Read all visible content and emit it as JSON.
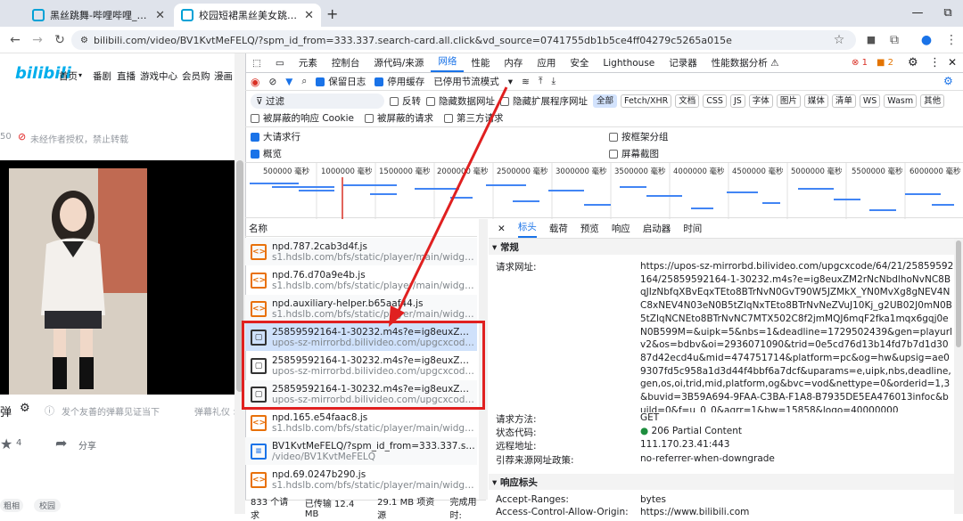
{
  "browser": {
    "tabs": [
      {
        "title": "黑丝跳舞-哔哩哔哩_bilibili",
        "active": false
      },
      {
        "title": "校园短裙黑丝美女跳舞。_哔哩哔",
        "active": true
      }
    ],
    "new_tab": "+",
    "url": "bilibili.com/video/BV1KvtMeFELQ/?spm_id_from=333.337.search-card.all.click&vd_source=0741755db1b5ce4ff04279c5265a015e",
    "window": {
      "minimize": "—",
      "restore": "⧉"
    }
  },
  "site": {
    "logo": "bilibili",
    "nav": [
      "首页",
      "番剧",
      "直播",
      "游戏中心",
      "会员购",
      "漫画"
    ],
    "meta": "50",
    "no_repost": "未经作者授权，禁止转载",
    "danmaku_placeholder": "发个友善的弹幕见证当下",
    "danmaku_etiquette": "弹幕礼仪 >",
    "coin_count": "4",
    "share": "分享",
    "tags": [
      "粗相",
      "校园"
    ]
  },
  "devtools": {
    "panels": [
      "元素",
      "控制台",
      "源代码/来源",
      "网络",
      "性能",
      "内存",
      "应用",
      "安全",
      "Lighthouse",
      "记录器",
      "性能数据分析 ⚠"
    ],
    "active_panel": "网络",
    "errors": "1",
    "warnings": "2",
    "toolbar": {
      "preserve_log": "保留日志",
      "disable_cache": "停用缓存",
      "throttle": "已停用节流模式"
    },
    "filter": {
      "placeholder": "过滤",
      "invert": "反转",
      "hide_data": "隐藏数据网址",
      "hide_ext": "隐藏扩展程序网址",
      "types": [
        "全部",
        "Fetch/XHR",
        "文档",
        "CSS",
        "JS",
        "字体",
        "图片",
        "媒体",
        "清单",
        "WS",
        "Wasm",
        "其他"
      ]
    },
    "options": {
      "blocked_cookies": "被屏蔽的响应 Cookie",
      "blocked_requests": "被屏蔽的请求",
      "third_party": "第三方请求",
      "big_rows": "大请求行",
      "group_by_frame": "按框架分组",
      "overview": "概览",
      "screenshots": "屏幕截图"
    },
    "timeline_ticks": [
      "500000 毫秒",
      "1000000 毫秒",
      "1500000 毫秒",
      "2000000 毫秒",
      "2500000 毫秒",
      "3000000 毫秒",
      "3500000 毫秒",
      "4000000 毫秒",
      "4500000 毫秒",
      "5000000 毫秒",
      "5500000 毫秒",
      "6000000 毫秒"
    ],
    "list_header": "名称",
    "requests": [
      {
        "name": "npd.787.2cab3d4f.js",
        "path": "s1.hdslb.com/bfs/static/player/main/widgets",
        "type": "script"
      },
      {
        "name": "npd.76.d70a9e4b.js",
        "path": "s1.hdslb.com/bfs/static/player/main/widgets",
        "type": "script"
      },
      {
        "name": "npd.auxiliary-helper.b65aaf44.js",
        "path": "s1.hdslb.com/bfs/static/player/main/widgets",
        "type": "script"
      },
      {
        "name": "25859592164-1-30232.m4s?e=ig8euxZM2rNcNb...",
        "path": "upos-sz-mirrorbd.bilivideo.com/upgcxcode/64/21...",
        "type": "media"
      },
      {
        "name": "25859592164-1-30232.m4s?e=ig8euxZM2rNcNb...",
        "path": "upos-sz-mirrorbd.bilivideo.com/upgcxcode/64/21...",
        "type": "media"
      },
      {
        "name": "25859592164-1-30232.m4s?e=ig8euxZM2rNcNb...",
        "path": "upos-sz-mirrorbd.bilivideo.com/upgcxcode/64/21...",
        "type": "media"
      },
      {
        "name": "npd.165.e54faac8.js",
        "path": "s1.hdslb.com/bfs/static/player/main/widgets",
        "type": "script"
      },
      {
        "name": "BV1KvtMeFELQ/?spm_id_from=333.337.search-ca...",
        "path": "/video/BV1KvtMeFELQ",
        "type": "doc"
      },
      {
        "name": "npd.69.0247b290.js",
        "path": "s1.hdslb.com/bfs/static/player/main/widgets",
        "type": "script"
      }
    ],
    "detail_tabs": [
      "标头",
      "载荷",
      "预览",
      "响应",
      "启动器",
      "时间"
    ],
    "general_title": "常规",
    "general": {
      "url_label": "请求网址:",
      "url": "https://upos-sz-mirrorbd.bilivideo.com/upgcxcode/64/21/25859592164/25859592164-1-30232.m4s?e=ig8euxZM2rNcNbdlhoNvNC8BqJIzNbfqXBvEqxTEto8BTrNvN0GvT90W5JZMkX_YN0MvXg8gNEV4NC8xNEV4N03eN0B5tZlqNxTEto8BTrNvNeZVuJ10Kj_g2UB02J0mN0B5tZlqNCNEto8BTrNvNC7MTX502C8f2jmMQJ6mqF2fka1mqx6gqj0eN0B599M=&uipk=5&nbs=1&deadline=1729502439&gen=playurlv2&os=bdbv&oi=2936071090&trid=0e5cd76d13b14fd7b7d1d3087d42ecd4u&mid=474751714&platform=pc&og=hw&upsig=ae09307fd5c958a1d3d44f4bbf6a7dcf&uparams=e,uipk,nbs,deadline,gen,os,oi,trid,mid,platform,og&bvc=vod&nettype=0&orderid=1,3&buvid=3B59A694-9FAA-C3BA-F1A8-B7935DE5EA476013infoc&build=0&f=u_0_0&agrr=1&bw=15858&logo=40000000",
      "method_label": "请求方法:",
      "method": "GET",
      "status_label": "状态代码:",
      "status": "206 Partial Content",
      "remote_label": "远程地址:",
      "remote": "111.170.23.41:443",
      "referrer_label": "引荐来源网址政策:",
      "referrer": "no-referrer-when-downgrade"
    },
    "response_title": "响应标头",
    "response_headers": [
      {
        "k": "Accept-Ranges:",
        "v": "bytes"
      },
      {
        "k": "Access-Control-Allow-Origin:",
        "v": "https://www.bilibili.com"
      }
    ],
    "status_bar": {
      "requests": "833 个请求",
      "transferred": "已传输 12.4 MB",
      "resources": "29.1 MB 项资源",
      "finish": "完成用时:"
    }
  },
  "colors": {
    "accent": "#1a73e8",
    "highlight": "#e02020",
    "bili": "#00aeec"
  }
}
